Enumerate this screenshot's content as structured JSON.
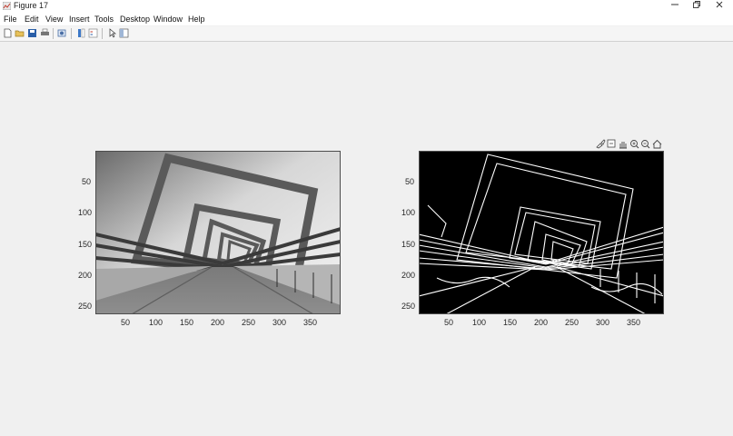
{
  "window": {
    "title": "Figure 17"
  },
  "menu": [
    "File",
    "Edit",
    "View",
    "Insert",
    "Tools",
    "Desktop",
    "Window",
    "Help"
  ],
  "toolbar_icons": [
    "new-figure-icon",
    "open-file-icon",
    "save-icon",
    "print-icon",
    "link-icon",
    "insert-colorbar-icon",
    "insert-legend-icon",
    "pointer-icon",
    "property-inspector-icon"
  ],
  "axes_toolbar_icons": [
    "brush-icon",
    "data-tips-icon",
    "pan-icon",
    "zoom-in-icon",
    "zoom-out-icon",
    "home-icon"
  ],
  "axes": [
    {
      "image": "grayscale photo of a twisting square-frame pedestrian bridge",
      "x_ticks": [
        "50",
        "100",
        "150",
        "200",
        "250",
        "300",
        "350"
      ],
      "y_ticks": [
        "50",
        "100",
        "150",
        "200",
        "250"
      ]
    },
    {
      "image": "edge-detection result (white edges on black)",
      "x_ticks": [
        "50",
        "100",
        "150",
        "200",
        "250",
        "300",
        "350"
      ],
      "y_ticks": [
        "50",
        "100",
        "150",
        "200",
        "250"
      ]
    }
  ]
}
